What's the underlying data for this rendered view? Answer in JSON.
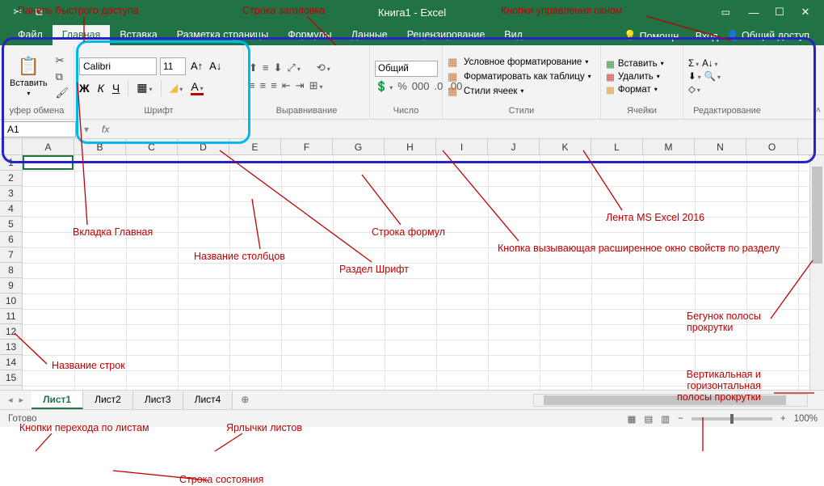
{
  "title": "Книга1 - Excel",
  "qat_dropdown": "▾",
  "tabs": [
    "Файл",
    "Главная",
    "Вставка",
    "Разметка страницы",
    "Формулы",
    "Данные",
    "Рецензирование",
    "Вид"
  ],
  "tellme": "Помощн...",
  "signin": "Вход",
  "share": "Общий доступ",
  "ribbon": {
    "clipboard": {
      "paste": "Вставить",
      "label": "уфер обмена"
    },
    "font": {
      "name": "Calibri",
      "size": "11",
      "bold": "Ж",
      "italic": "К",
      "underline": "Ч",
      "label": "Шрифт"
    },
    "alignment": {
      "label": "Выравнивание"
    },
    "number": {
      "format": "Общий",
      "label": "Число"
    },
    "styles": {
      "cond": "Условное форматирование",
      "table": "Форматировать как таблицу",
      "cell": "Стили ячеек",
      "label": "Стили"
    },
    "cells": {
      "insert": "Вставить",
      "delete": "Удалить",
      "format": "Формат",
      "label": "Ячейки"
    },
    "editing": {
      "label": "Редактирование"
    }
  },
  "name_box": "A1",
  "columns": [
    "A",
    "B",
    "C",
    "D",
    "E",
    "F",
    "G",
    "H",
    "I",
    "J",
    "K",
    "L",
    "M",
    "N",
    "O"
  ],
  "rows": [
    "1",
    "2",
    "3",
    "4",
    "5",
    "6",
    "7",
    "8",
    "9",
    "10",
    "11",
    "12",
    "13",
    "14",
    "15"
  ],
  "sheets": [
    "Лист1",
    "Лист2",
    "Лист3",
    "Лист4"
  ],
  "status": {
    "ready": "Готово",
    "zoom": "100%"
  },
  "annotations": {
    "qat": "Панель быстрого доступа",
    "titlebar": "Строка заголовка",
    "winbtns": "Кнопки управления окном",
    "hometab": "Вкладка Главная",
    "colnames": "Название столбцов",
    "fbar": "Строка формул",
    "fontsec": "Раздел Шрифт",
    "launcher": "Кнопка вызывающая расширенное окно свойств по разделу",
    "ribbon": "Лента MS Excel 2016",
    "scrollthumb": "Бегунок полосы прокрутки",
    "rownames": "Название строк",
    "scrollbars": "Вертикальная и горизонтальная полосы прокрутки",
    "sheetnav": "Кнопки перехода по листам",
    "sheettabs": "Ярлычки листов",
    "statusbar": "Строка состояния"
  }
}
